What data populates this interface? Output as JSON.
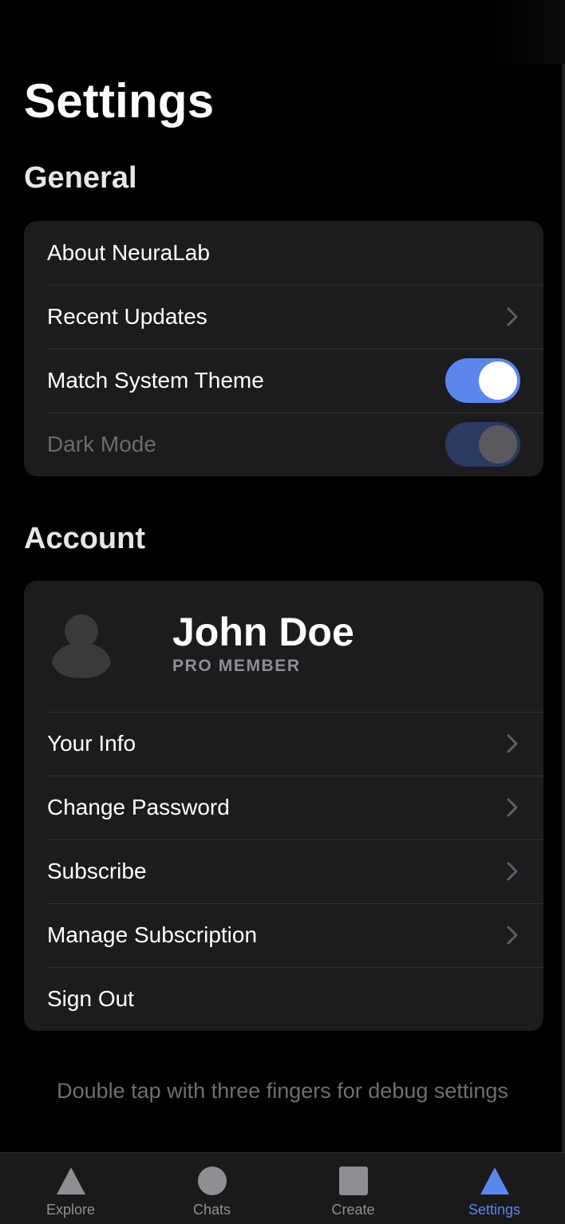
{
  "title": "Settings",
  "general": {
    "heading": "General",
    "items": [
      {
        "label": "About NeuraLab"
      },
      {
        "label": "Recent Updates"
      },
      {
        "label": "Match System Theme"
      },
      {
        "label": "Dark Mode"
      }
    ],
    "match_system_theme_on": true,
    "dark_mode_enabled": false
  },
  "account": {
    "heading": "Account",
    "profile": {
      "name": "John Doe",
      "tier": "PRO MEMBER"
    },
    "items": [
      {
        "label": "Your Info"
      },
      {
        "label": "Change Password"
      },
      {
        "label": "Subscribe"
      },
      {
        "label": "Manage Subscription"
      },
      {
        "label": "Sign Out"
      }
    ]
  },
  "footer_hint": "Double tap with three fingers for debug settings",
  "tabs": [
    {
      "label": "Explore",
      "icon": "triangle-icon"
    },
    {
      "label": "Chats",
      "icon": "circle-icon"
    },
    {
      "label": "Create",
      "icon": "square-icon"
    },
    {
      "label": "Settings",
      "icon": "triangle-icon",
      "active": true
    }
  ],
  "colors": {
    "accent": "#5b86ee",
    "background": "#000000",
    "card": "#1c1c1e",
    "muted_text": "#8e8e93"
  }
}
